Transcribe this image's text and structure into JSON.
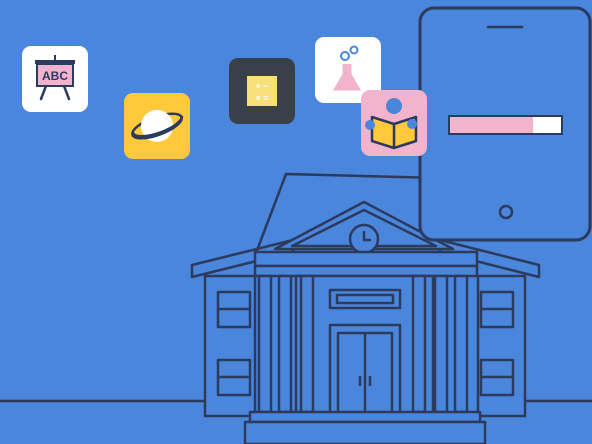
{
  "scene": {
    "background_color": "#4a86dc",
    "line_color": "#2c3a5e"
  },
  "app_icons": [
    {
      "name": "abc-easel-icon",
      "text": "ABC",
      "tile_color": "#ffffff",
      "accent_color": "#f2b4cc"
    },
    {
      "name": "planet-icon",
      "tile_color": "#ffc83d"
    },
    {
      "name": "calculator-icon",
      "symbols": "+ − × =",
      "tile_color": "#3a404a",
      "accent_color": "#f7e07a"
    },
    {
      "name": "flask-icon",
      "tile_color": "#ffffff",
      "accent_color": "#f2b4cc"
    },
    {
      "name": "reading-student-icon",
      "tile_color": "#f2b4cc",
      "accent_color": "#ffc83d"
    }
  ],
  "phone": {
    "frame_color": "#4a86dc",
    "progress_fraction": 0.75,
    "progress_color": "#f2b4cc"
  },
  "building": {
    "clock_icon": "clock-icon"
  }
}
